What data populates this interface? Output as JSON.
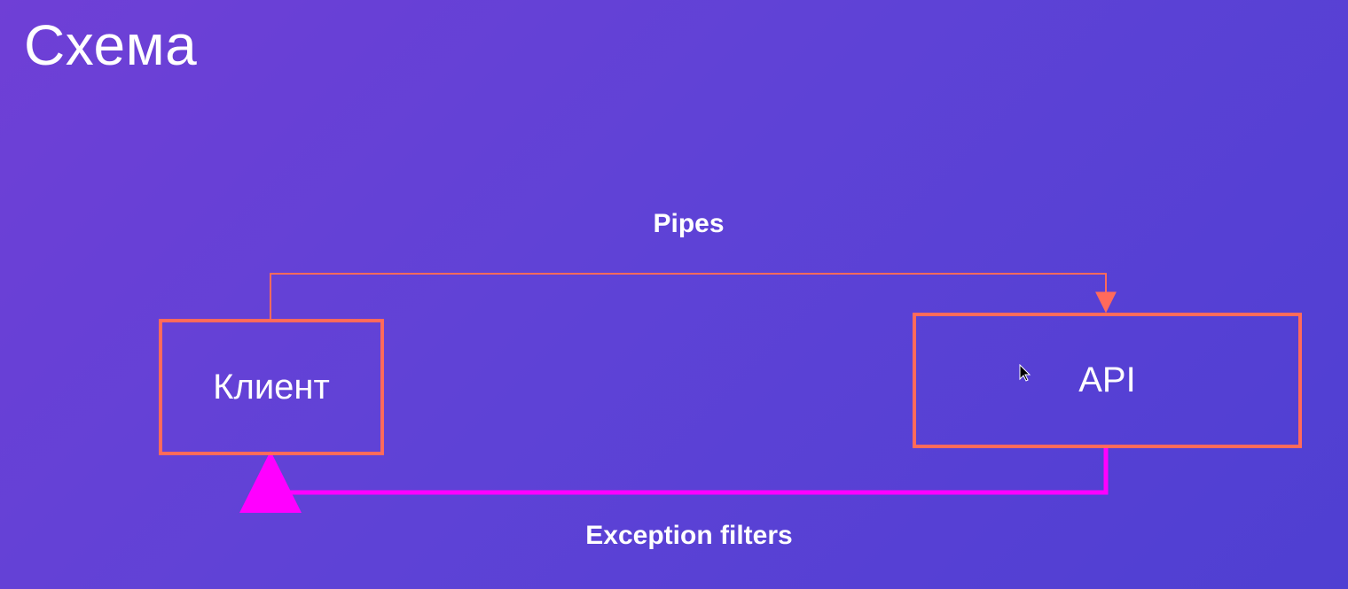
{
  "slide": {
    "title": "Схема"
  },
  "nodes": {
    "client": {
      "label": "Клиент"
    },
    "api": {
      "label": "API"
    }
  },
  "edges": {
    "pipes": {
      "label": "Pipes",
      "color": "#ff6a5b"
    },
    "exception": {
      "label": "Exception filters",
      "color": "#ff00ff"
    }
  },
  "colors": {
    "node_border": "#ff6a5b",
    "text": "#ffffff"
  },
  "icons": {
    "cursor": "mouse-pointer-icon"
  }
}
